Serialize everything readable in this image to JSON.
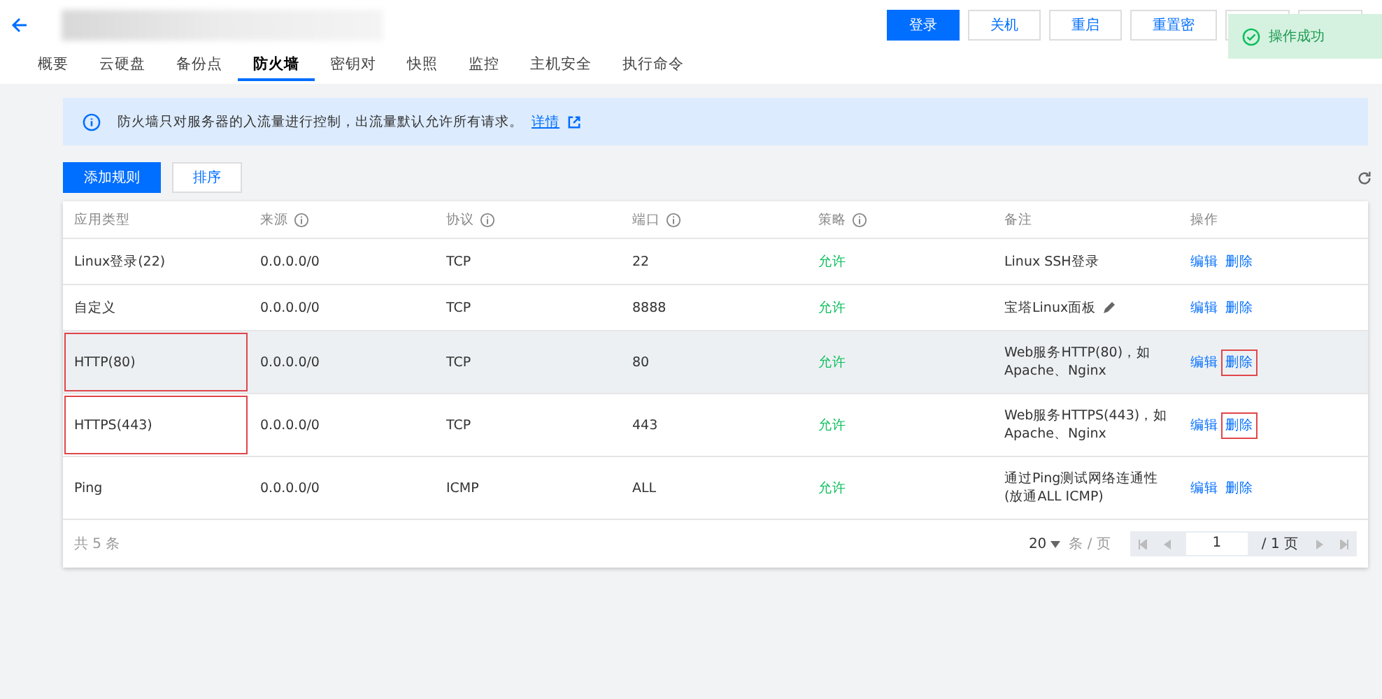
{
  "header": {
    "actions": [
      {
        "label": "登录",
        "primary": true
      },
      {
        "label": "关机",
        "primary": false
      },
      {
        "label": "重启",
        "primary": false
      },
      {
        "label": "重置密",
        "primary": false
      }
    ]
  },
  "tabs": [
    {
      "label": "概要",
      "selected": false
    },
    {
      "label": "云硬盘",
      "selected": false
    },
    {
      "label": "备份点",
      "selected": false
    },
    {
      "label": "防火墙",
      "selected": true
    },
    {
      "label": "密钥对",
      "selected": false
    },
    {
      "label": "快照",
      "selected": false
    },
    {
      "label": "监控",
      "selected": false
    },
    {
      "label": "主机安全",
      "selected": false
    },
    {
      "label": "执行命令",
      "selected": false
    }
  ],
  "toast": {
    "text": "操作成功"
  },
  "notice": {
    "text": "防火墙只对服务器的入流量进行控制，出流量默认允许所有请求。",
    "link": "详情"
  },
  "toolbar": {
    "add_button": "添加规则",
    "sort_button": "排序"
  },
  "table": {
    "columns": [
      {
        "label": "应用类型",
        "info": false
      },
      {
        "label": "来源",
        "info": true
      },
      {
        "label": "协议",
        "info": true
      },
      {
        "label": "端口",
        "info": true
      },
      {
        "label": "策略",
        "info": true
      },
      {
        "label": "备注",
        "info": false
      },
      {
        "label": "操作",
        "info": false
      }
    ],
    "rows": [
      {
        "type": "Linux登录(22)",
        "source": "0.0.0.0/0",
        "protocol": "TCP",
        "port": "22",
        "policy": "允许",
        "note": "Linux SSH登录",
        "editable_note": false,
        "hovered": false,
        "highlighted": false,
        "edit": "编辑",
        "delete": "删除"
      },
      {
        "type": "自定义",
        "source": "0.0.0.0/0",
        "protocol": "TCP",
        "port": "8888",
        "policy": "允许",
        "note": "宝塔Linux面板",
        "editable_note": true,
        "hovered": false,
        "highlighted": false,
        "edit": "编辑",
        "delete": "删除"
      },
      {
        "type": "HTTP(80)",
        "source": "0.0.0.0/0",
        "protocol": "TCP",
        "port": "80",
        "policy": "允许",
        "note": "Web服务HTTP(80)，如Apache、Nginx",
        "editable_note": false,
        "hovered": true,
        "highlighted": true,
        "edit": "编辑",
        "delete": "删除"
      },
      {
        "type": "HTTPS(443)",
        "source": "0.0.0.0/0",
        "protocol": "TCP",
        "port": "443",
        "policy": "允许",
        "note": "Web服务HTTPS(443)，如Apache、Nginx",
        "editable_note": false,
        "hovered": false,
        "highlighted": true,
        "edit": "编辑",
        "delete": "删除"
      },
      {
        "type": "Ping",
        "source": "0.0.0.0/0",
        "protocol": "ICMP",
        "port": "ALL",
        "policy": "允许",
        "note": "通过Ping测试网络连通性(放通ALL ICMP)",
        "editable_note": false,
        "hovered": false,
        "highlighted": false,
        "edit": "编辑",
        "delete": "删除"
      }
    ],
    "total": "共 5 条",
    "pagination": {
      "page_size": "20",
      "per_page": "条 / 页",
      "page": "1",
      "pages": "/ 1 页"
    }
  }
}
